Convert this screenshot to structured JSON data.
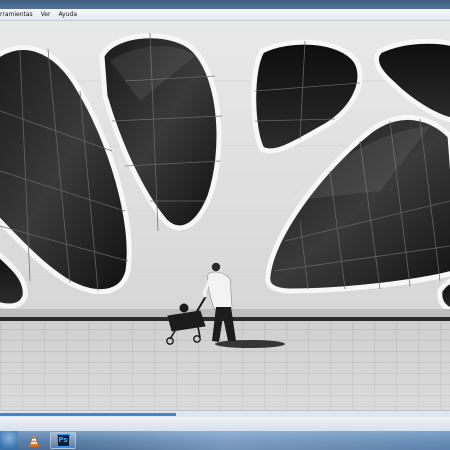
{
  "window": {
    "menu": [
      {
        "label": "rramientas"
      },
      {
        "label": "Ver"
      },
      {
        "label": "Ayuda"
      }
    ]
  },
  "player": {
    "media_description_icon": "photo-frame",
    "progress_fraction": 0.39
  },
  "taskbar": {
    "apps": [
      {
        "icon": "vlc-cone-icon"
      },
      {
        "icon": "photoshop-icon",
        "label": "Ps"
      }
    ]
  }
}
